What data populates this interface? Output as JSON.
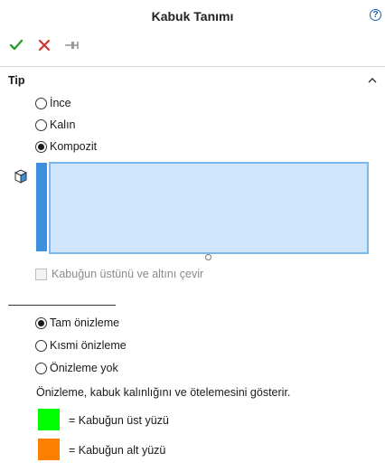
{
  "window": {
    "title": "Kabuk Tanımı",
    "help_glyph": "?"
  },
  "toolbar": {
    "ok": "checkmark-icon",
    "cancel": "close-icon",
    "pin": "pushpin-icon",
    "ok_color": "#2e9e2e",
    "cancel_color": "#d0342c"
  },
  "section": {
    "title": "Tip"
  },
  "type_options": [
    {
      "label": "İnce",
      "checked": false
    },
    {
      "label": "Kalın",
      "checked": false
    },
    {
      "label": "Kompozit",
      "checked": true
    }
  ],
  "selection_list": {
    "icon": "body-selection-cube-icon",
    "items": []
  },
  "flip_checkbox": {
    "label": "Kabuğun üstünü ve altını çevir",
    "checked": false,
    "enabled": false
  },
  "preview_options": [
    {
      "label": "Tam önizleme",
      "checked": true
    },
    {
      "label": "Kısmi önizleme",
      "checked": false
    },
    {
      "label": "Önizleme yok",
      "checked": false
    }
  ],
  "note": "Önizleme, kabuk kalınlığını ve ötelemesini gösterir.",
  "legend": [
    {
      "label": "= Kabuğun üst yüzü",
      "color": "#00ff00"
    },
    {
      "label": "= Kabuğun alt yüzü",
      "color": "#ff8000"
    }
  ]
}
